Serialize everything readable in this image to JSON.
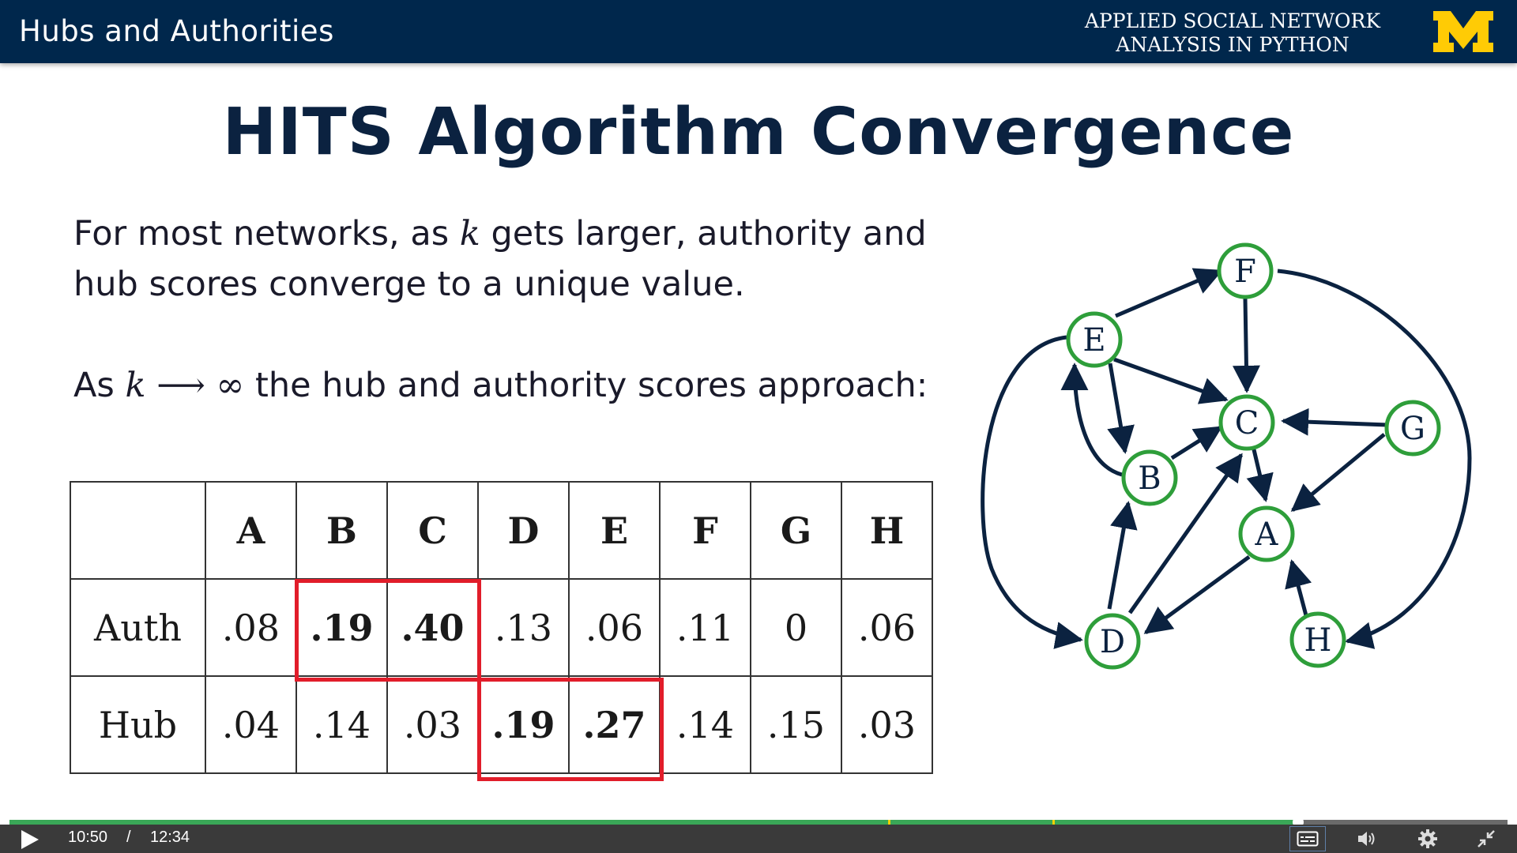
{
  "header": {
    "title": "Hubs and Authorities",
    "course_line1": "APPLIED SOCIAL NETWORK",
    "course_line2": "ANALYSIS IN PYTHON",
    "logo_letter": "M",
    "logo_color": "#ffcb05",
    "background": "#00274c"
  },
  "slide": {
    "title": "HITS Algorithm Convergence",
    "para1": {
      "before_k": "For most networks,  as ",
      "k": "k",
      "after_k": " gets larger, authority and hub scores converge to a unique value."
    },
    "para2": {
      "before": "As ",
      "k": "k",
      "arrow": " ⟶ ∞",
      "after": " the hub and authority scores approach:"
    }
  },
  "table": {
    "headers": [
      "",
      "A",
      "B",
      "C",
      "D",
      "E",
      "F",
      "G",
      "H"
    ],
    "rows": [
      {
        "label": "Auth",
        "values": [
          ".08",
          ".19",
          ".40",
          ".13",
          ".06",
          ".11",
          "0",
          ".06"
        ],
        "bold": [
          false,
          true,
          true,
          false,
          false,
          false,
          false,
          false
        ]
      },
      {
        "label": "Hub",
        "values": [
          ".04",
          ".14",
          ".03",
          ".19",
          ".27",
          ".14",
          ".15",
          ".03"
        ],
        "bold": [
          false,
          false,
          false,
          true,
          true,
          false,
          false,
          false
        ]
      }
    ],
    "highlight_color": "#e11d2a"
  },
  "graph": {
    "node_color": "#2e9e3a",
    "edge_color": "#0b2240",
    "nodes": [
      "A",
      "B",
      "C",
      "D",
      "E",
      "F",
      "G",
      "H"
    ]
  },
  "player": {
    "current_time": "10:50",
    "separator": "/",
    "total_time": "12:34",
    "progress": 0.8604,
    "progress_color": "#3aa757"
  },
  "icons": {
    "play": "play-icon",
    "captions": "captions-icon",
    "volume": "volume-icon",
    "settings": "gear-icon",
    "fullscreen": "exit-fullscreen-icon"
  }
}
